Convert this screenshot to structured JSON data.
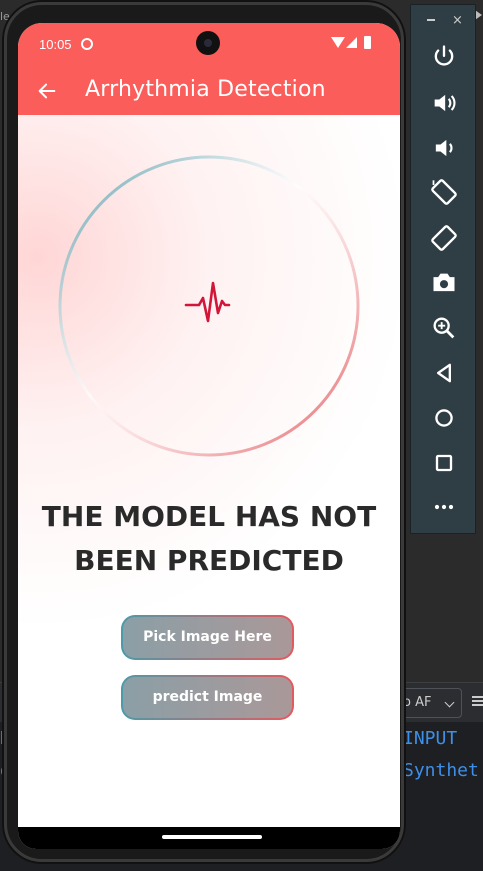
{
  "ide": {
    "top_text": "le",
    "dropdown_text": "o AF",
    "right_code_lines": [
      "INPUT",
      "Synthet"
    ],
    "left_code_lines": [
      "H",
      "d"
    ]
  },
  "status_bar": {
    "time": "10:05"
  },
  "app_bar": {
    "title": "Arrhythmia Detection"
  },
  "main": {
    "message_line1": "THE MODEL HAS NOT",
    "message_line2": "BEEN PREDICTED",
    "pick_button_label": "Pick Image Here",
    "predict_button_label": "predict Image"
  },
  "colors": {
    "app_bar": "#fa5d5a",
    "ring_start": "#4e9aa8",
    "ring_end": "#e35a5f",
    "heartbeat": "#d1163a"
  },
  "emulator": {
    "minimize_label": "–",
    "close_label": "×",
    "buttons": [
      "power-icon",
      "volume-up-icon",
      "volume-down-icon",
      "rotate-left-icon",
      "rotate-right-icon",
      "camera-icon",
      "zoom-icon",
      "back-icon",
      "home-icon",
      "overview-icon",
      "more-icon"
    ]
  }
}
